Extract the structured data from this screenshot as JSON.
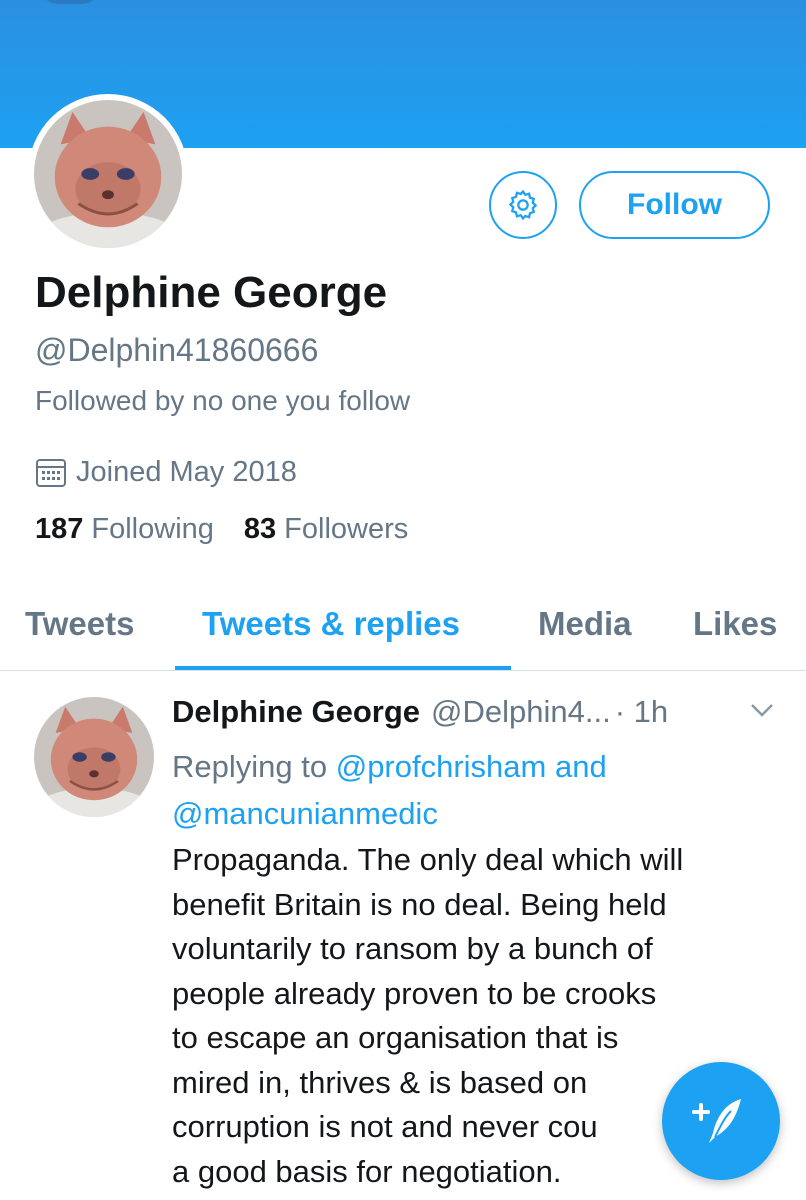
{
  "colors": {
    "accent": "#1da1f2",
    "text": "#14171a",
    "secondary": "#657786"
  },
  "profile": {
    "name": "Delphine George",
    "handle": "@Delphin41860666",
    "followed_by": "Followed by no one you follow",
    "joined": "Joined May 2018",
    "following_count": "187",
    "following_label": "Following",
    "followers_count": "83",
    "followers_label": "Followers",
    "avatar_icon": "kitten-avatar"
  },
  "actions": {
    "settings_icon": "gear-icon",
    "follow_label": "Follow"
  },
  "tabs": [
    {
      "label": "Tweets",
      "active": false
    },
    {
      "label": "Tweets & replies",
      "active": true
    },
    {
      "label": "Media",
      "active": false
    },
    {
      "label": "Likes",
      "active": false
    }
  ],
  "tweet": {
    "name": "Delphine George",
    "handle": "@Delphin4...",
    "time": "· 1h",
    "replying_to_label": "Replying to",
    "mention_1": "@profchrisham and",
    "mention_2": "@mancunianmedic",
    "text_lines": [
      "Propaganda. The only deal which will",
      "benefit Britain is no deal. Being held",
      "voluntarily to ransom by a bunch of",
      "people already proven to be crooks",
      "to escape an organisation that is",
      "mired in, thrives & is based on",
      "corruption is not and never cou",
      "a good basis for negotiation."
    ]
  },
  "compose": {
    "icon": "compose-tweet-icon"
  }
}
